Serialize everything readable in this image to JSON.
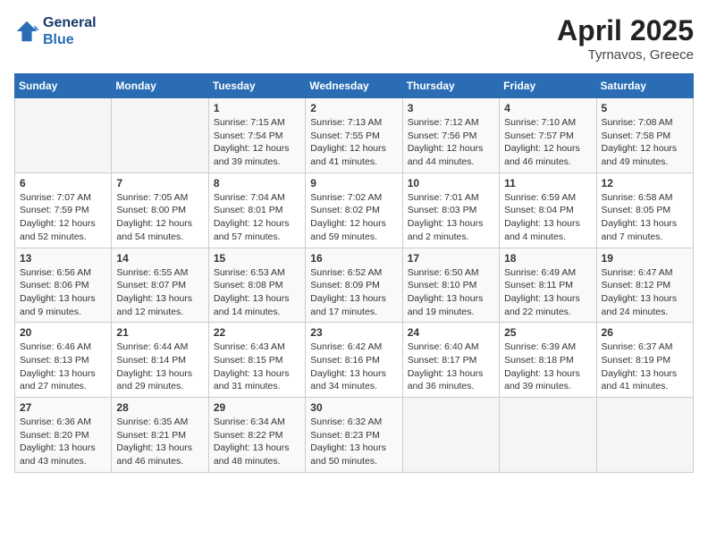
{
  "header": {
    "logo_line1": "General",
    "logo_line2": "Blue",
    "month": "April 2025",
    "location": "Tyrnavos, Greece"
  },
  "weekdays": [
    "Sunday",
    "Monday",
    "Tuesday",
    "Wednesday",
    "Thursday",
    "Friday",
    "Saturday"
  ],
  "weeks": [
    [
      {
        "day": "",
        "content": ""
      },
      {
        "day": "",
        "content": ""
      },
      {
        "day": "1",
        "content": "Sunrise: 7:15 AM\nSunset: 7:54 PM\nDaylight: 12 hours and 39 minutes."
      },
      {
        "day": "2",
        "content": "Sunrise: 7:13 AM\nSunset: 7:55 PM\nDaylight: 12 hours and 41 minutes."
      },
      {
        "day": "3",
        "content": "Sunrise: 7:12 AM\nSunset: 7:56 PM\nDaylight: 12 hours and 44 minutes."
      },
      {
        "day": "4",
        "content": "Sunrise: 7:10 AM\nSunset: 7:57 PM\nDaylight: 12 hours and 46 minutes."
      },
      {
        "day": "5",
        "content": "Sunrise: 7:08 AM\nSunset: 7:58 PM\nDaylight: 12 hours and 49 minutes."
      }
    ],
    [
      {
        "day": "6",
        "content": "Sunrise: 7:07 AM\nSunset: 7:59 PM\nDaylight: 12 hours and 52 minutes."
      },
      {
        "day": "7",
        "content": "Sunrise: 7:05 AM\nSunset: 8:00 PM\nDaylight: 12 hours and 54 minutes."
      },
      {
        "day": "8",
        "content": "Sunrise: 7:04 AM\nSunset: 8:01 PM\nDaylight: 12 hours and 57 minutes."
      },
      {
        "day": "9",
        "content": "Sunrise: 7:02 AM\nSunset: 8:02 PM\nDaylight: 12 hours and 59 minutes."
      },
      {
        "day": "10",
        "content": "Sunrise: 7:01 AM\nSunset: 8:03 PM\nDaylight: 13 hours and 2 minutes."
      },
      {
        "day": "11",
        "content": "Sunrise: 6:59 AM\nSunset: 8:04 PM\nDaylight: 13 hours and 4 minutes."
      },
      {
        "day": "12",
        "content": "Sunrise: 6:58 AM\nSunset: 8:05 PM\nDaylight: 13 hours and 7 minutes."
      }
    ],
    [
      {
        "day": "13",
        "content": "Sunrise: 6:56 AM\nSunset: 8:06 PM\nDaylight: 13 hours and 9 minutes."
      },
      {
        "day": "14",
        "content": "Sunrise: 6:55 AM\nSunset: 8:07 PM\nDaylight: 13 hours and 12 minutes."
      },
      {
        "day": "15",
        "content": "Sunrise: 6:53 AM\nSunset: 8:08 PM\nDaylight: 13 hours and 14 minutes."
      },
      {
        "day": "16",
        "content": "Sunrise: 6:52 AM\nSunset: 8:09 PM\nDaylight: 13 hours and 17 minutes."
      },
      {
        "day": "17",
        "content": "Sunrise: 6:50 AM\nSunset: 8:10 PM\nDaylight: 13 hours and 19 minutes."
      },
      {
        "day": "18",
        "content": "Sunrise: 6:49 AM\nSunset: 8:11 PM\nDaylight: 13 hours and 22 minutes."
      },
      {
        "day": "19",
        "content": "Sunrise: 6:47 AM\nSunset: 8:12 PM\nDaylight: 13 hours and 24 minutes."
      }
    ],
    [
      {
        "day": "20",
        "content": "Sunrise: 6:46 AM\nSunset: 8:13 PM\nDaylight: 13 hours and 27 minutes."
      },
      {
        "day": "21",
        "content": "Sunrise: 6:44 AM\nSunset: 8:14 PM\nDaylight: 13 hours and 29 minutes."
      },
      {
        "day": "22",
        "content": "Sunrise: 6:43 AM\nSunset: 8:15 PM\nDaylight: 13 hours and 31 minutes."
      },
      {
        "day": "23",
        "content": "Sunrise: 6:42 AM\nSunset: 8:16 PM\nDaylight: 13 hours and 34 minutes."
      },
      {
        "day": "24",
        "content": "Sunrise: 6:40 AM\nSunset: 8:17 PM\nDaylight: 13 hours and 36 minutes."
      },
      {
        "day": "25",
        "content": "Sunrise: 6:39 AM\nSunset: 8:18 PM\nDaylight: 13 hours and 39 minutes."
      },
      {
        "day": "26",
        "content": "Sunrise: 6:37 AM\nSunset: 8:19 PM\nDaylight: 13 hours and 41 minutes."
      }
    ],
    [
      {
        "day": "27",
        "content": "Sunrise: 6:36 AM\nSunset: 8:20 PM\nDaylight: 13 hours and 43 minutes."
      },
      {
        "day": "28",
        "content": "Sunrise: 6:35 AM\nSunset: 8:21 PM\nDaylight: 13 hours and 46 minutes."
      },
      {
        "day": "29",
        "content": "Sunrise: 6:34 AM\nSunset: 8:22 PM\nDaylight: 13 hours and 48 minutes."
      },
      {
        "day": "30",
        "content": "Sunrise: 6:32 AM\nSunset: 8:23 PM\nDaylight: 13 hours and 50 minutes."
      },
      {
        "day": "",
        "content": ""
      },
      {
        "day": "",
        "content": ""
      },
      {
        "day": "",
        "content": ""
      }
    ]
  ]
}
